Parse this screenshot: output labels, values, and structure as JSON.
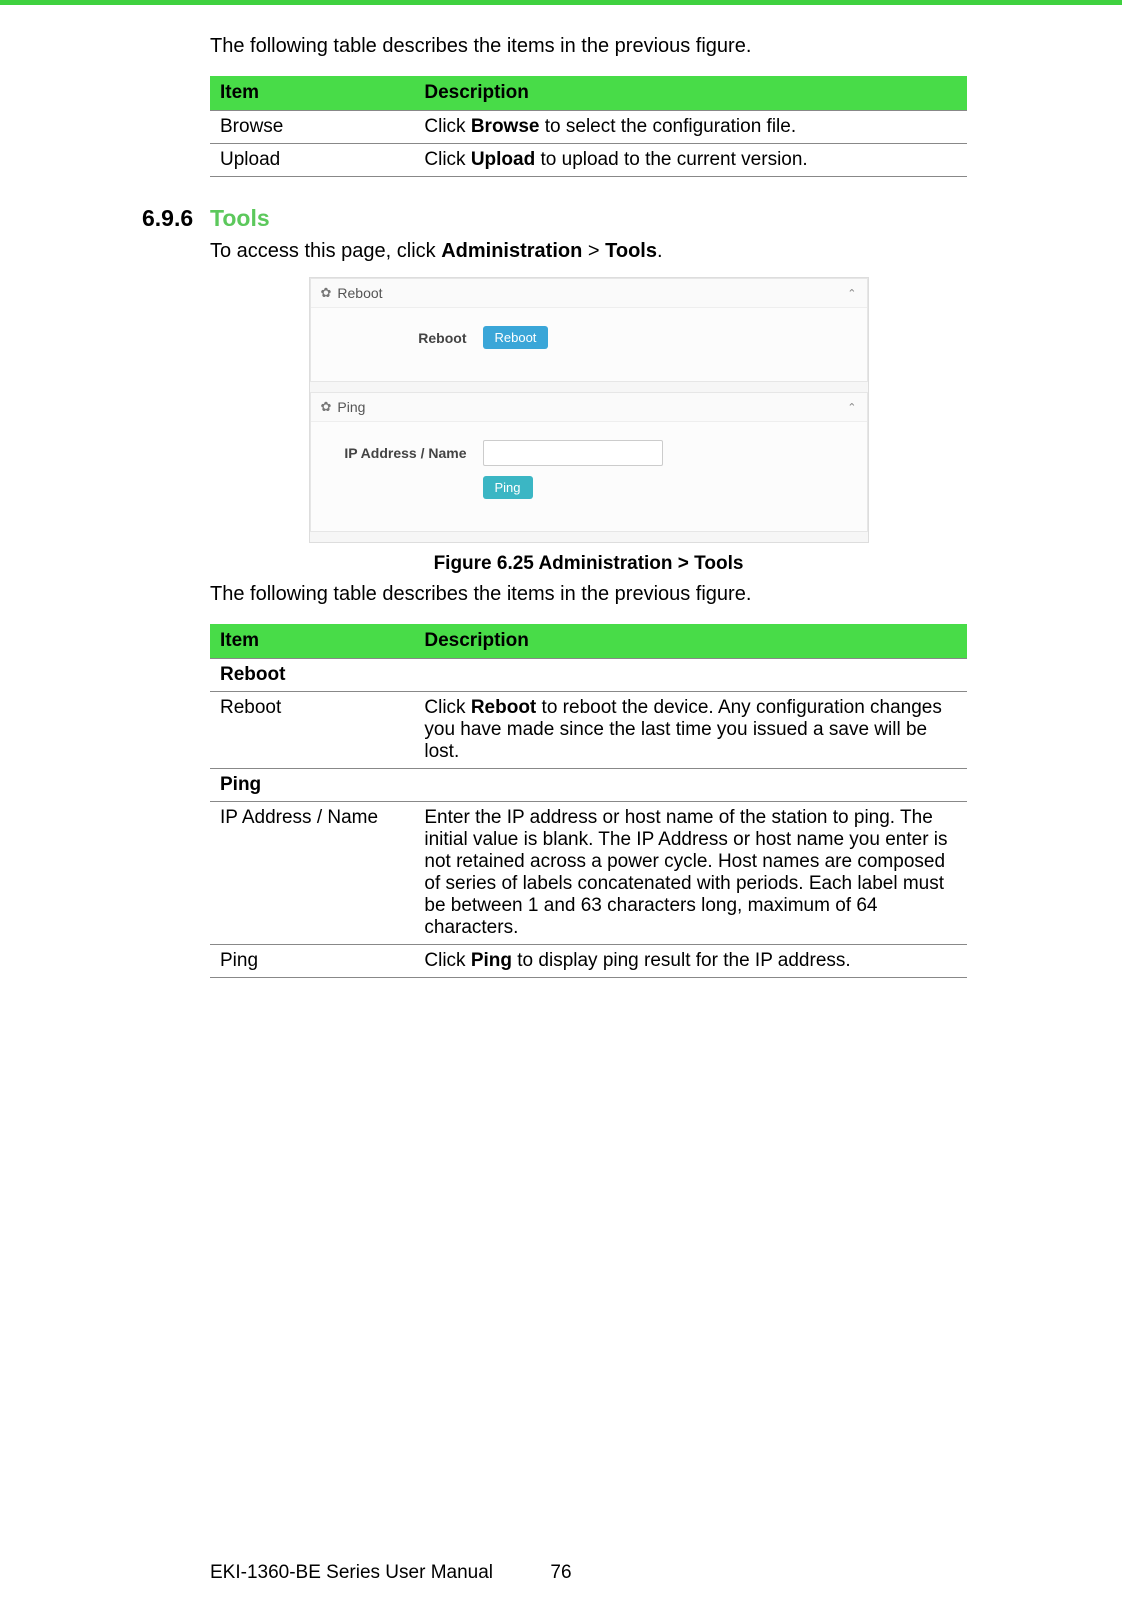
{
  "intro1": "The following table describes the items in the previous figure.",
  "table1": {
    "headers": {
      "item": "Item",
      "desc": "Description"
    },
    "rows": [
      {
        "item": "Browse",
        "desc_pre": "Click ",
        "desc_b": "Browse",
        "desc_post": " to select the configuration file."
      },
      {
        "item": "Upload",
        "desc_pre": "Click ",
        "desc_b": "Upload",
        "desc_post": " to upload to the current version."
      }
    ]
  },
  "section": {
    "num": "6.9.6",
    "title": "Tools"
  },
  "access": {
    "pre": "To access this page, click ",
    "b1": "Administration",
    "mid": " > ",
    "b2": "Tools",
    "post": "."
  },
  "figure": {
    "panel1": {
      "title": "Reboot",
      "label": "Reboot",
      "button": "Reboot"
    },
    "panel2": {
      "title": "Ping",
      "label": "IP Address / Name",
      "input_value": "",
      "button": "Ping"
    }
  },
  "caption": "Figure 6.25 Administration > Tools",
  "intro2": "The following table describes the items in the previous figure.",
  "table2": {
    "headers": {
      "item": "Item",
      "desc": "Description"
    },
    "rows": [
      {
        "section": true,
        "item": "Reboot"
      },
      {
        "item": "Reboot",
        "desc_pre": "Click ",
        "desc_b": "Reboot",
        "desc_post": " to reboot the device. Any configuration changes you have made since the last time you issued a save will be lost."
      },
      {
        "section": true,
        "item": "Ping"
      },
      {
        "item": "IP Address / Name",
        "desc_plain": "Enter the IP address or host name of the station to ping. The initial value is blank. The IP Address or host name you enter is not retained across a power cycle. Host names are composed of series of labels concatenated with periods. Each label must be between 1 and 63 characters long, maximum of 64 characters."
      },
      {
        "item": "Ping",
        "desc_pre": "Click ",
        "desc_b": "Ping",
        "desc_post": " to display ping result for the IP address."
      }
    ]
  },
  "footer": {
    "left": "EKI-1360-BE Series User Manual",
    "page": "76"
  }
}
